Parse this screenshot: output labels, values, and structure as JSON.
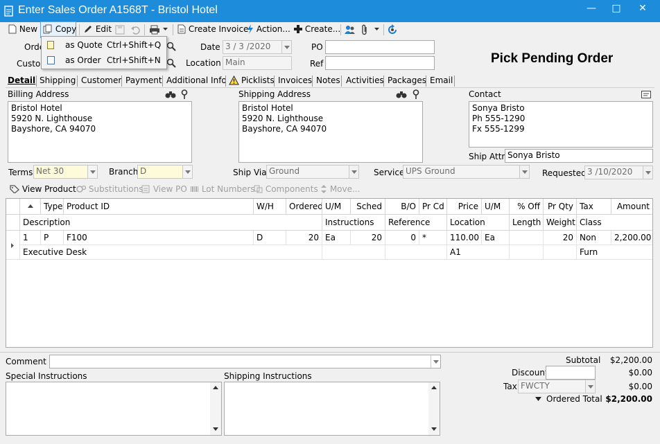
{
  "window": {
    "title": "Enter Sales Order A1568T - Bristol Hotel",
    "minimize": "—",
    "maximize": "□",
    "close": "✕"
  },
  "toolbar": {
    "new_label": "New",
    "copy_label": "Copy",
    "edit_label": "Edit",
    "create_invoice_label": "Create Invoice",
    "action_label": "Action...",
    "create_label": "Create..."
  },
  "copy_menu": {
    "items": [
      {
        "label": "as Quote",
        "shortcut": "Ctrl+Shift+Q"
      },
      {
        "label": "as Order",
        "shortcut": "Ctrl+Shift+N"
      }
    ]
  },
  "header": {
    "order_label": "Orde",
    "customer_label": "Custo",
    "date_label": "Date",
    "date_value": "3 / 3 /2020",
    "location_label": "Location",
    "location_value": "Main",
    "po_label": "PO",
    "po_value": "",
    "ref_label": "Ref",
    "ref_value": "",
    "status": "Pick Pending Order"
  },
  "tabs": [
    "Detail",
    "Shipping",
    "Customer",
    "Payment",
    "Additional Info",
    "Picklists",
    "Invoices",
    "Notes",
    "Activities",
    "Packages",
    "Email"
  ],
  "billing": {
    "label": "Billing Address",
    "lines": [
      "Bristol Hotel",
      "5920 N. Lighthouse",
      "Bayshore, CA 94070"
    ]
  },
  "shipping": {
    "label": "Shipping Address",
    "lines": [
      "Bristol Hotel",
      "5920 N. Lighthouse",
      "Bayshore, CA 94070"
    ]
  },
  "contact": {
    "label": "Contact",
    "lines": [
      "Sonya Bristo",
      "Ph 555-1290",
      "Fx 555-1299"
    ],
    "ship_attn_label": "Ship Attn",
    "ship_attn_value": "Sonya Bristo"
  },
  "terms": {
    "label": "Terms",
    "value": "Net 30"
  },
  "branch": {
    "label": "Branch",
    "value": "D"
  },
  "ship_via": {
    "label": "Ship Via",
    "value": "Ground"
  },
  "service": {
    "label": "Service",
    "value": "UPS Ground"
  },
  "requested": {
    "label": "Requested",
    "value": "3 /10/2020"
  },
  "line_toolbar": [
    "View Product",
    "Substitutions",
    "View PO",
    "Lot Numbers",
    "Components",
    "Move..."
  ],
  "grid": {
    "header1": [
      "Type",
      "Product ID",
      "W/H",
      "Ordered",
      "U/M",
      "Sched",
      "B/O",
      "Pr Cd",
      "Price",
      "U/M",
      "% Off",
      "Pr Qty",
      "Tax",
      "Amount"
    ],
    "header2": [
      "Description",
      "Instructions",
      "Reference",
      "Location",
      "Length",
      "Weight",
      "Class"
    ],
    "rows": [
      {
        "line": "1",
        "type": "P",
        "product_id": "F100",
        "wh": "D",
        "ordered": "20",
        "um": "Ea",
        "sched": "20",
        "bo": "0",
        "prcd": "*",
        "price": "110.00",
        "um2": "Ea",
        "pct_off": "",
        "pr_qty": "20",
        "tax": "Non",
        "amount": "2,200.00",
        "description": "Executive Desk",
        "instructions": "",
        "reference": "",
        "location": "A1",
        "length": "",
        "weight": "",
        "class": "Furn"
      }
    ]
  },
  "footer": {
    "comment_label": "Comment",
    "comment_value": "",
    "special_label": "Special Instructions",
    "shipping_instr_label": "Shipping Instructions",
    "subtotal_label": "Subtotal",
    "subtotal_value": "$2,200.00",
    "discount_label": "Discount",
    "discount_value": "$0.00",
    "tax_label": "Tax",
    "tax_code": "FWCTY",
    "tax_value": "$0.00",
    "ordered_total_label": "Ordered Total",
    "ordered_total_value": "$2,200.00"
  }
}
